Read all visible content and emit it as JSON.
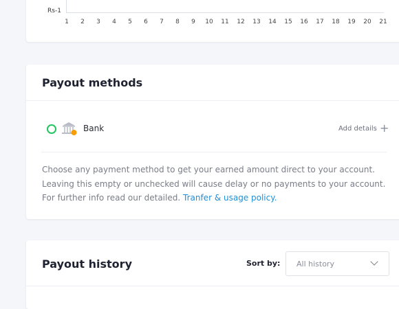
{
  "chart": {
    "y_tick_label": "Rs-1",
    "x_ticks": [
      "1",
      "2",
      "3",
      "4",
      "5",
      "6",
      "7",
      "8",
      "9",
      "10",
      "11",
      "12",
      "13",
      "14",
      "15",
      "16",
      "17",
      "18",
      "19",
      "20",
      "21"
    ]
  },
  "payout_methods": {
    "title": "Payout methods",
    "method": {
      "icon": "bank-icon",
      "label": "Bank",
      "selected": true,
      "add_details_label": "Add details",
      "add_icon": "plus-icon"
    },
    "help_text": "Choose any payment method to get your earned amount direct to your account. Leaving this empty or unchecked will cause delay or no payments to your account. For further info read our detailed.",
    "help_link": "Tranfer & usage policy.",
    "colors": {
      "radio": "#22c55e",
      "link": "#1f8fd6",
      "badge": "#f59e0b"
    }
  },
  "payout_history": {
    "title": "Payout history",
    "sort_label": "Sort by:",
    "sort_value": "All history"
  }
}
